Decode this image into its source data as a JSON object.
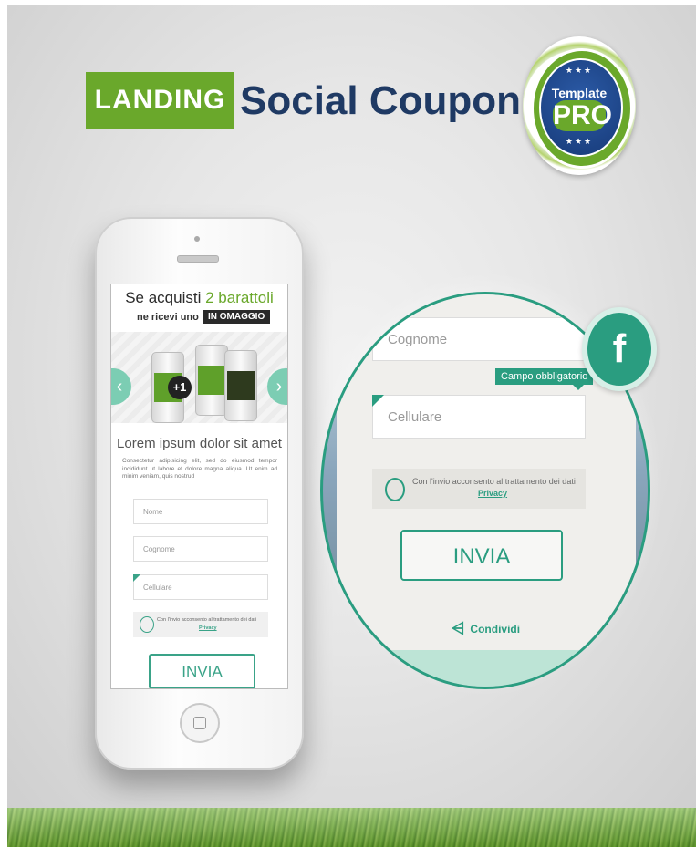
{
  "header": {
    "tag": "LANDING",
    "title": "Social Coupon"
  },
  "badge": {
    "line1": "Template",
    "line2": "PRO",
    "stars": "★★★"
  },
  "phone_screen": {
    "headline_prefix": "Se acquisti",
    "headline_highlight": "2 barattoli",
    "subheadline": "ne ricevi uno",
    "gift_badge": "IN OMAGGIO",
    "plus_badge": "+1",
    "heading": "Lorem ipsum dolor sit amet",
    "description": "Consectetur adipisicing elit, sed do eiusmod tempor incididunt ut labore et dolore magna aliqua. Ut enim ad minim veniam, quis nostrud",
    "inputs": {
      "nome": "Nome",
      "cognome": "Cognome",
      "cellulare": "Cellulare"
    },
    "consent_text": "Con l'invio acconsento al trattamento dei dati",
    "consent_link": "Privacy",
    "submit": "INVIA",
    "prev_arrow": "‹",
    "next_arrow": "›"
  },
  "zoom": {
    "cognome_placeholder": "Cognome",
    "tooltip": "Campo obbligatorio",
    "cellulare_placeholder": "Cellulare",
    "consent_text": "Con l'invio acconsento al trattamento dei dati",
    "consent_link": "Privacy",
    "submit": "INVIA",
    "share_icon": "⩤",
    "share_label": "Condividi"
  },
  "facebook": {
    "glyph": "f"
  },
  "colors": {
    "green": "#6aa82b",
    "navy": "#1f3a64",
    "teal": "#2a9d80"
  }
}
